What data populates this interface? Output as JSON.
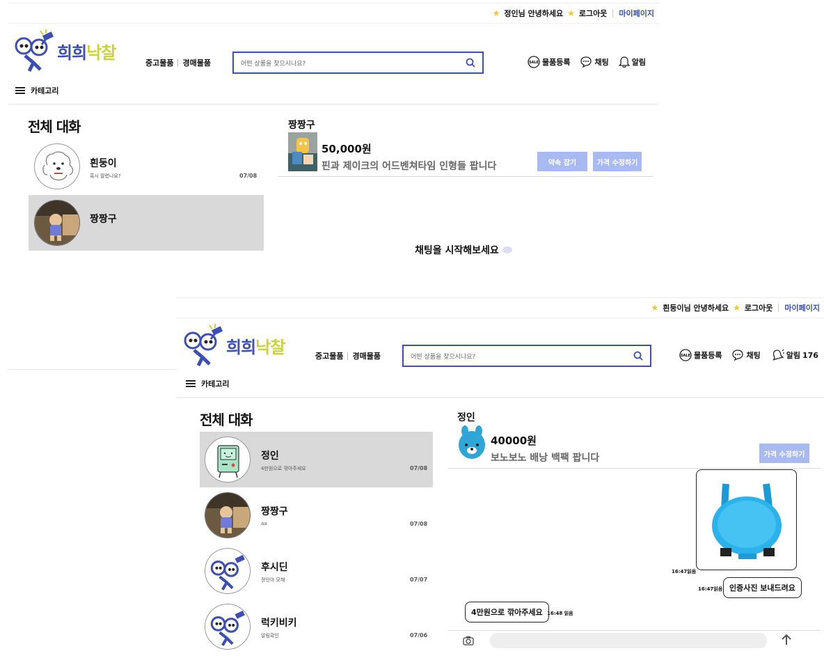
{
  "colors": {
    "brand_blue": "#3b4fb5",
    "brand_lime": "#c9d33a",
    "button_blue": "#a9b9f2",
    "active_gray": "#d9d9d9",
    "star": "#f4c430"
  },
  "s1": {
    "topbar": {
      "greeting": "정인님 안녕하세요",
      "logout": "로그아웃",
      "mypage": "마이페이지"
    },
    "logo": {
      "part1": "희희",
      "part2": "낙찰"
    },
    "nav": {
      "used": "중고물품",
      "auction": "경매물품"
    },
    "search": {
      "placeholder": "어떤 상품을 찾으시나요?"
    },
    "right": {
      "register": "물품등록",
      "chat": "채팅",
      "alarm": "알림"
    },
    "category": "카테고리",
    "title": "전체 대화",
    "chats": [
      {
        "name": "흰둥이",
        "msg": "혹시 팔렸나요?",
        "date": "07/08"
      },
      {
        "name": "짱짱구",
        "msg": "",
        "date": ""
      }
    ],
    "product": {
      "seller": "짱짱구",
      "price": "50,000원",
      "title": "핀과 제이크의 어드벤쳐타임 인형들 팝니다",
      "btn_promise": "약속 잡기",
      "btn_price": "가격 수정하기"
    },
    "empty": "채팅을 시작해보세요"
  },
  "s2": {
    "topbar": {
      "greeting": "흰둥이님 안녕하세요",
      "logout": "로그아웃",
      "mypage": "마이페이지"
    },
    "logo": {
      "part1": "희희",
      "part2": "낙찰"
    },
    "nav": {
      "used": "중고물품",
      "auction": "경매물품"
    },
    "search": {
      "placeholder": "어떤 상품을 찾으시나요?"
    },
    "right": {
      "register": "물품등록",
      "chat": "채팅",
      "alarm": "알림",
      "alarm_count": "176"
    },
    "category": "카테고리",
    "title": "전체 대화",
    "chats": [
      {
        "name": "정인",
        "msg": "4만원으로 깎아주세요",
        "date": "07/08"
      },
      {
        "name": "짱짱구",
        "msg": "aa",
        "date": "07/08"
      },
      {
        "name": "후시딘",
        "msg": "정인아 모해",
        "date": "07/07"
      },
      {
        "name": "럭키비키",
        "msg": "알림확인",
        "date": "07/06"
      }
    ],
    "product": {
      "seller": "정인",
      "price": "40000원",
      "title": "보노보노 배낭 백팩 팝니다",
      "btn_price": "가격 수정하기"
    },
    "messages": [
      {
        "time": "16:47읽음"
      },
      {
        "time": "16:47읽음",
        "text": "인증사진 보내드려요"
      },
      {
        "time": "16:48 읽음",
        "text": "4만원으로 깎아주세요"
      }
    ]
  }
}
